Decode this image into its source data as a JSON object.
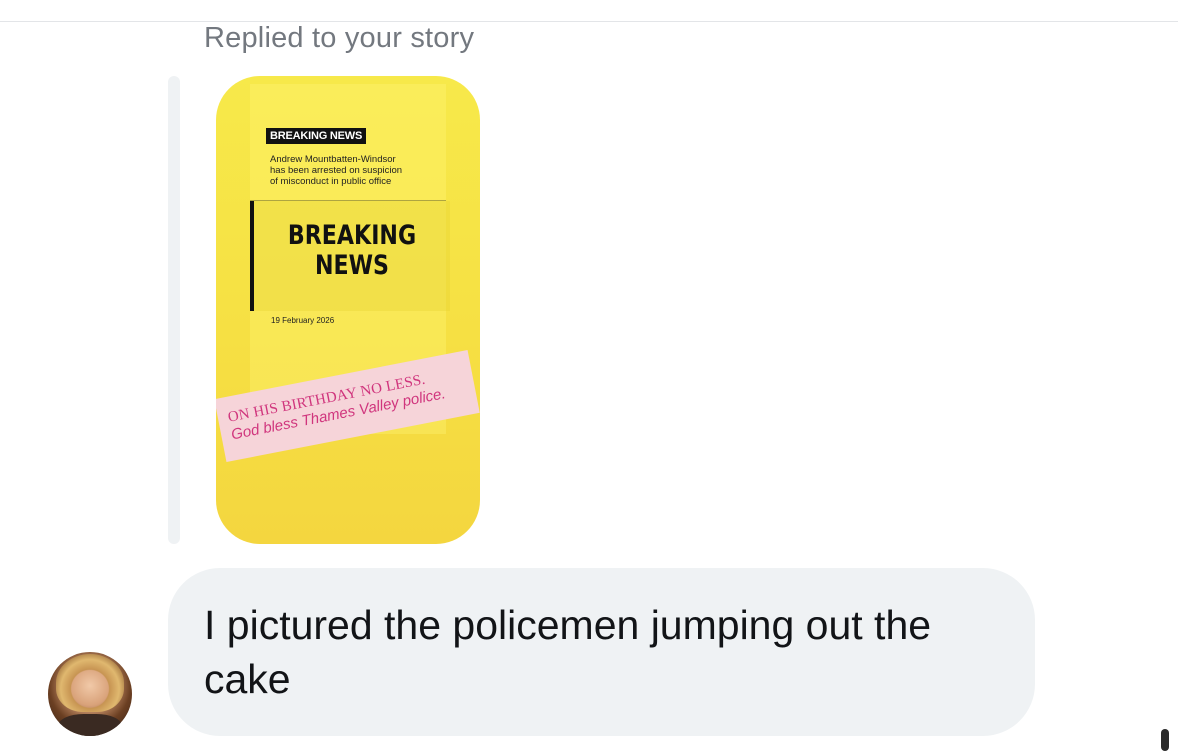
{
  "conversation": {
    "reply_label": "Replied to your story",
    "story": {
      "tag": "BREAKING NEWS",
      "headline_lines": [
        "Andrew Mountbatten-Windsor",
        "has been arrested on suspicion",
        "of misconduct in public office"
      ],
      "big_title_line1": "BREAKING",
      "big_title_line2": "NEWS",
      "date": "19 February 2026",
      "caption_line1": "ON HIS BIRTHDAY NO LESS.",
      "caption_line2": "God bless Thames Valley police.",
      "background_color": "#f6e043",
      "caption_color": "#d0357d",
      "sticker_color": "#f6d4d9"
    },
    "message": {
      "text": "I pictured the policemen jumping out the cake",
      "bubble_color": "#eff2f4"
    },
    "avatar_icon": "user-avatar"
  }
}
